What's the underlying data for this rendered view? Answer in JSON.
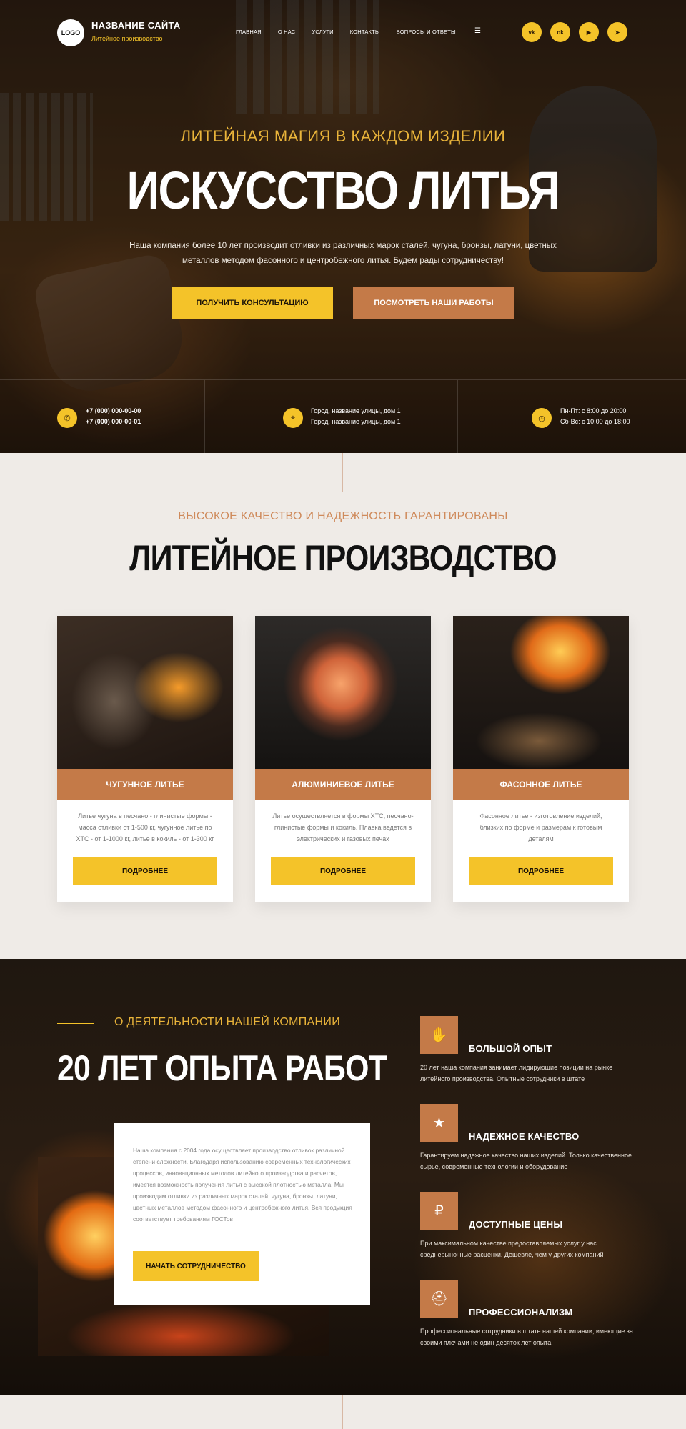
{
  "header": {
    "logo": "LOGO",
    "site_name": "НАЗВАНИЕ САЙТА",
    "site_sub": "Литейное производство",
    "menu": [
      "ГЛАВНАЯ",
      "О НАС",
      "УСЛУГИ",
      "КОНТАКТЫ",
      "ВОПРОСЫ И ОТВЕТЫ"
    ],
    "socials": [
      "vk-icon",
      "ok-icon",
      "youtube-icon",
      "telegram-icon"
    ],
    "social_glyphs": [
      "vk",
      "ok",
      "▶",
      "➤"
    ]
  },
  "hero": {
    "kicker": "ЛИТЕЙНАЯ МАГИЯ В КАЖДОМ ИЗДЕЛИИ",
    "title": "ИСКУССТВО ЛИТЬЯ",
    "description": "Наша компания более 10 лет производит отливки из различных марок сталей, чугуна, бронзы, латуни, цветных металлов методом фасонного и центробежного литья. Будем рады сотрудничеству!",
    "btn_consult": "ПОЛУЧИТЬ КОНСУЛЬТАЦИЮ",
    "btn_works": "ПОСМОТРЕТЬ НАШИ РАБОТЫ"
  },
  "contacts": {
    "phone1": "+7 (000) 000-00-00",
    "phone2": "+7 (000) 000-00-01",
    "address1": "Город, название улицы, дом 1",
    "address2": "Город, название улицы, дом 1",
    "hours1": "Пн-Пт: с 8:00 до 20:00",
    "hours2": "Сб-Вс: с 10:00 до 18:00"
  },
  "production": {
    "kicker": "ВЫСОКОЕ КАЧЕСТВО И НАДЕЖНОСТЬ ГАРАНТИРОВАНЫ",
    "title": "ЛИТЕЙНОЕ ПРОИЗВОДСТВО",
    "cards": [
      {
        "title": "ЧУГУННОЕ ЛИТЬЕ",
        "text": "Литье чугуна в песчано - глинистые формы - масса отливки от 1-500 кг, чугунное литье по ХТС - от 1-1000 кг, литье в кокиль - от 1-300 кг",
        "button": "ПОДРОБНЕЕ"
      },
      {
        "title": "АЛЮМИНИЕВОЕ ЛИТЬЕ",
        "text": "Литье осуществляется в формы ХТС, песчано-глинистые формы и кокиль. Плавка ведется в электрических и газовых печах",
        "button": "ПОДРОБНЕЕ"
      },
      {
        "title": "ФАСОННОЕ ЛИТЬЕ",
        "text": "Фасонное литье - изготовление изделий, близких по форме и размерам к готовым деталям",
        "button": "ПОДРОБНЕЕ"
      }
    ]
  },
  "about": {
    "kicker": "О ДЕЯТЕЛЬНОСТИ НАШЕЙ КОМПАНИИ",
    "title": "20 ЛЕТ ОПЫТА РАБОТ",
    "text": "Наша компания с 2004 года осуществляет производство отливок различной степени сложности. Благодаря использованию современных технологических процессов, инновационных методов литейного производства и расчетов, имеется возможность получения литья с высокой плотностью металла. Мы производим отливки из различных марок сталей, чугуна, бронзы, латуни, цветных металлов методом фасонного и центробежного литья. Вся продукция соответствует требованиям ГОСТов",
    "button": "НАЧАТЬ СОТРУДНИЧЕСТВО",
    "features": [
      {
        "icon": "hand-gear-icon",
        "glyph": "✋",
        "title": "БОЛЬШОЙ ОПЫТ",
        "text": "20 лет наша компания занимает лидирующие позиции на рынке литейного производства. Опытные сотрудники в штате"
      },
      {
        "icon": "award-icon",
        "glyph": "★",
        "title": "НАДЕЖНОЕ КАЧЕСТВО",
        "text": "Гарантируем надежное качество наших изделий. Только качественное сырье, современные технологии и оборудование"
      },
      {
        "icon": "coins-icon",
        "glyph": "₽",
        "title": "ДОСТУПНЫЕ ЦЕНЫ",
        "text": "При максимальном качестве предоставляемых услуг у нас среднерыночные расценки. Дешевле, чем у других компаний"
      },
      {
        "icon": "worker-icon",
        "glyph": "⛑",
        "title": "ПРОФЕССИОНАЛИЗМ",
        "text": "Профессиональные сотрудники в штате нашей компании, имеющие за своими плечами не один десяток лет опыта"
      }
    ]
  }
}
